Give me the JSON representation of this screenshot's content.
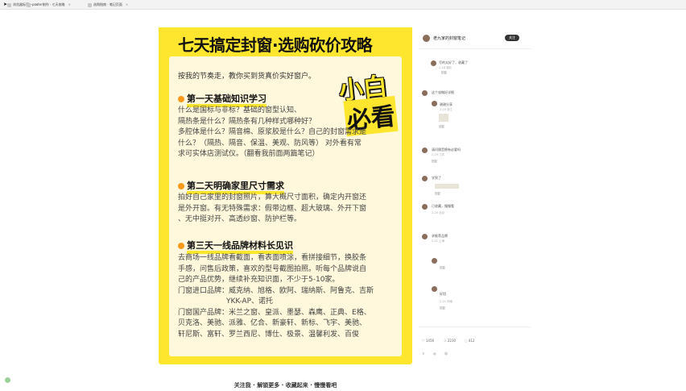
{
  "tabs": [
    {
      "label": "浏览器标签一"
    },
    {
      "label": "poster制作 · 七天攻略"
    },
    {
      "label": "选购指南 · 笔记页面"
    }
  ],
  "poster": {
    "title": "七天搞定封窗·选购砍价攻略",
    "intro": "按我的节奏走，教你买到货真价实好窗户。",
    "badge_line1": "小白",
    "badge_line2": "必看",
    "sections": [
      {
        "heading": "第一天基础知识学习",
        "lines": [
          "什么是国标与非标？基础的窗型认知、",
          "隔热条是什么？隔热条有几种样式哪种好？",
          "多腔体是什么？隔音棉、原浆胶是什么？自己的封窗需求是",
          "什么？（隔热、隔音、保温、美观、防风等） 对外看有常",
          "求可实体店测试仪。（翻看我前面两篇笔记）"
        ]
      },
      {
        "heading": "第二天明确家里尺寸需求",
        "lines": [
          "拍好自己家里的封窗照片，算大概尺寸面积，确定内开窗还",
          "是外开窗。有无特殊需求：假带边框、超大玻璃、外开下窗",
          "、无中挺对开、高透纱窗、防护栏等。"
        ]
      },
      {
        "heading": "第三天一线品牌材料长见识",
        "lines": [
          "去商场一线品牌看截面，看表面喷涂，看拼接细节，换胶条",
          "手感，问售后政策，喜欢的型号截图拍照。听每个品牌说自",
          "己的产品优势，继续补充知识面，不少于5-10家。",
          "门窗进口品牌：威克纳、旭格、欧阿、瑞纳斯、阿鲁克、吉斯",
          "YKK-AP、诺托",
          "门窗国产品牌：米兰之窗、皇派、墨瑟、森鹰、正典、E格、",
          "贝克洛、美驰、派雅、亿合、新豪轩、新标、飞宇、美驰、",
          "轩尼斯、富轩、罗兰西尼、博仕、极景、温馨利发、百俊"
        ]
      }
    ],
    "footer": "关注我 · 解锁更多 · 收藏起来 · 慢慢看吧"
  },
  "sidebar": {
    "author": "老九家的封窗笔记",
    "follow": "关注",
    "comments": [
      {
        "text": "写的太好了，收藏了",
        "meta": "2-18 湖北",
        "reply": "回复"
      },
      {
        "text": "这个攻略好详细",
        "meta": "2-18 广东",
        "reply": "回复"
      },
      {
        "text": "谢谢分享",
        "meta": "2-19 浙江",
        "reply": "回复"
      },
      {
        "text": "请问隔音棉有必要吗",
        "meta": "2-19 江苏",
        "reply": "回复"
      },
      {
        "text": "学到了",
        "meta": "2-20 山东",
        "reply": "回复"
      },
      {
        "text": "已收藏，慢慢看",
        "meta": "2-20 北京",
        "reply": "回复"
      },
      {
        "text": "求推荐品牌",
        "meta": "2-21 上海",
        "reply": "回复"
      },
      {
        "text": "好用",
        "meta": "2-21 河南",
        "reply": "回复"
      }
    ],
    "actions": {
      "like": "1456",
      "star": "2230",
      "comment": "412"
    }
  }
}
